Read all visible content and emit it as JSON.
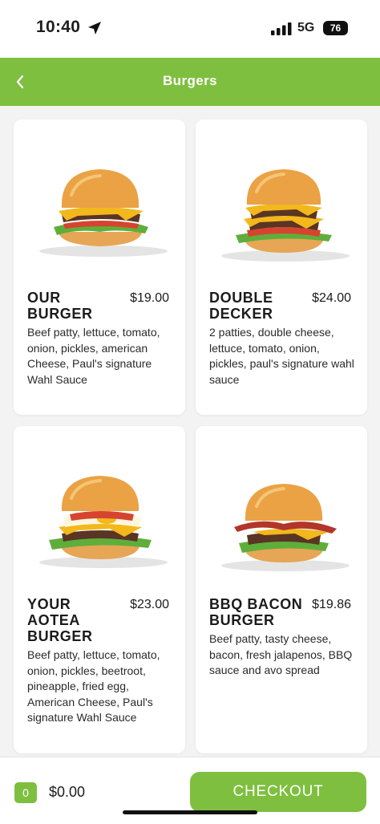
{
  "status_bar": {
    "time": "10:40",
    "network": "5G",
    "battery": "76",
    "location_icon": "location-arrow-icon",
    "signal_icon": "signal-bars-icon"
  },
  "header": {
    "title": "Burgers",
    "back_icon": "chevron-left-icon"
  },
  "colors": {
    "brand_green": "#7fbf3f",
    "background": "#f3f3f3",
    "card": "#ffffff"
  },
  "products": [
    {
      "name": "OUR BURGER",
      "price": "$19.00",
      "description": "Beef patty, lettuce, tomato, onion, pickles, american Cheese, Paul's signature Wahl Sauce"
    },
    {
      "name": "DOUBLE DECKER",
      "price": "$24.00",
      "description": "2 patties, double cheese, lettuce, tomato, onion, pickles, paul's signature wahl sauce"
    },
    {
      "name": "YOUR AOTEA BURGER",
      "price": "$23.00",
      "description": "Beef patty, lettuce, tomato, onion, pickles, beetroot, pineapple, fried egg, American Cheese, Paul's signature Wahl Sauce"
    },
    {
      "name": "BBQ BACON BURGER",
      "price": "$19.86",
      "description": "Beef patty, tasty cheese, bacon, fresh jalapenos, BBQ sauce and avo spread"
    }
  ],
  "footer": {
    "cart_count": "0",
    "cart_total": "$0.00",
    "checkout_label": "CHECKOUT"
  }
}
